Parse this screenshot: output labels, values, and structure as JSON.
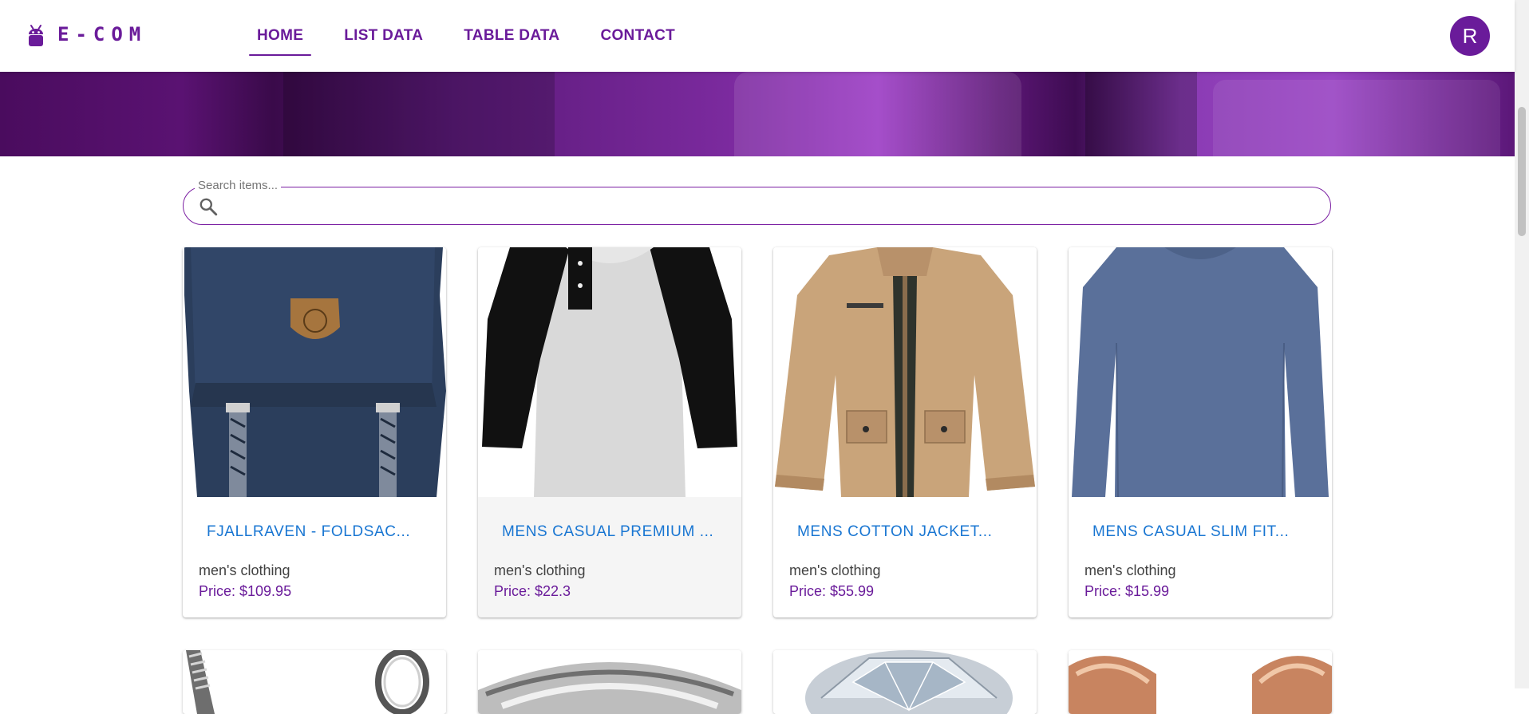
{
  "header": {
    "brand": "E-COM",
    "nav": [
      {
        "label": "HOME",
        "active": true
      },
      {
        "label": "LIST DATA",
        "active": false
      },
      {
        "label": "TABLE DATA",
        "active": false
      },
      {
        "label": "CONTACT",
        "active": false
      }
    ],
    "avatar_initial": "R"
  },
  "search": {
    "label": "Search items...",
    "value": ""
  },
  "products": [
    {
      "title": "FJALLRAVEN - FOLDSAC...",
      "category": "men's clothing",
      "price": "Price: $109.95"
    },
    {
      "title": "MENS CASUAL PREMIUM ...",
      "category": "men's clothing",
      "price": "Price: $22.3"
    },
    {
      "title": "MENS COTTON JACKET...",
      "category": "men's clothing",
      "price": "Price: $55.99"
    },
    {
      "title": "MENS CASUAL SLIM FIT...",
      "category": "men's clothing",
      "price": "Price: $15.99"
    }
  ],
  "colors": {
    "primary": "#6a1b9a",
    "link": "#1976d2"
  }
}
